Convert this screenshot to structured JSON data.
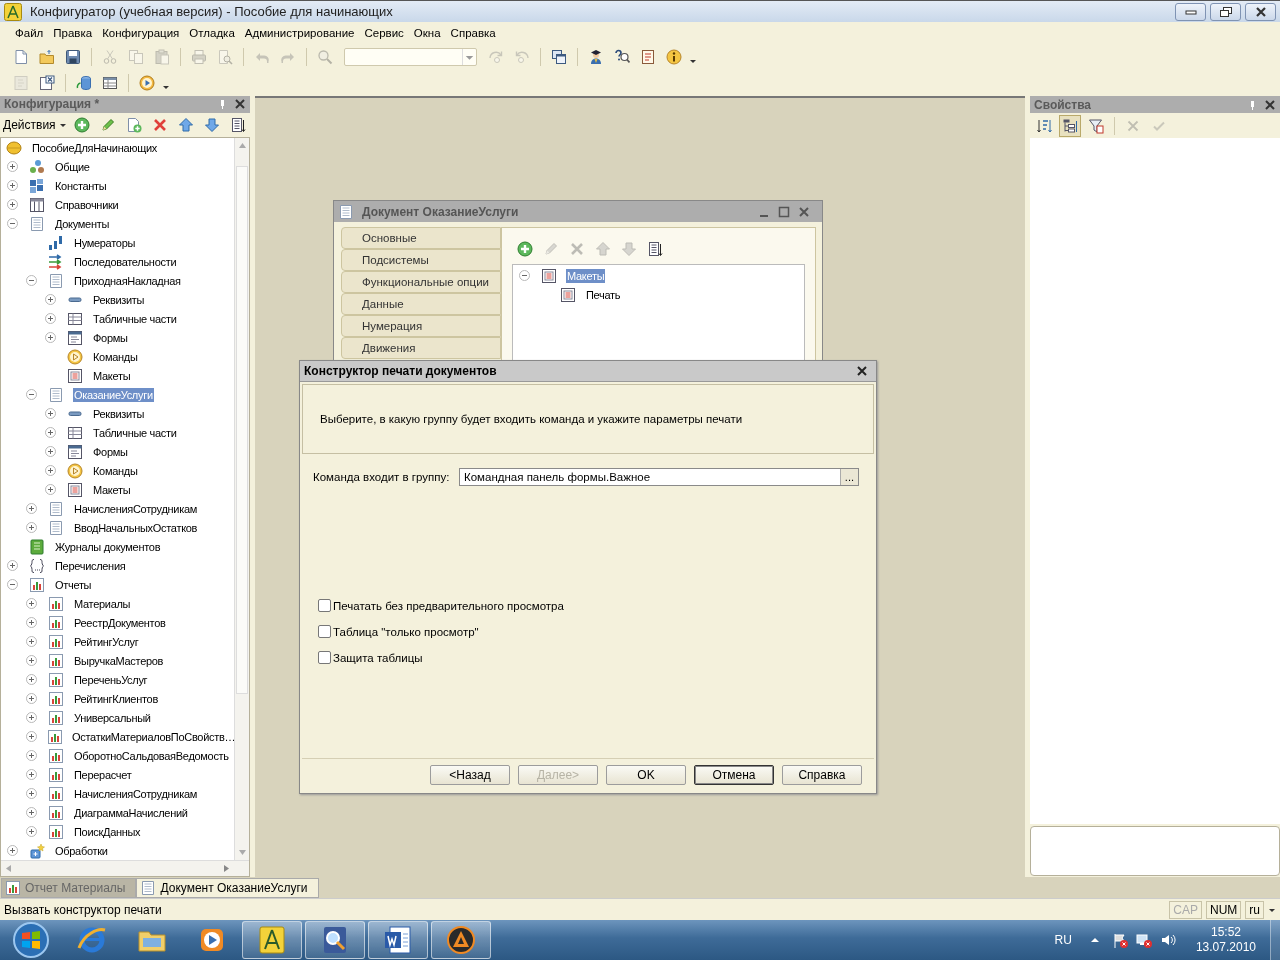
{
  "window": {
    "title": "Конфигуратор (учебная версия) - Пособие для начинающих"
  },
  "menu": [
    {
      "label": "Файл"
    },
    {
      "label": "Правка"
    },
    {
      "label": "Конфигурация"
    },
    {
      "label": "Отладка"
    },
    {
      "label": "Администрирование"
    },
    {
      "label": "Сервис"
    },
    {
      "label": "Окна"
    },
    {
      "label": "Справка"
    }
  ],
  "toolbar_main": [
    {
      "kind": "new",
      "disabled": false
    },
    {
      "kind": "open",
      "disabled": false
    },
    {
      "kind": "save",
      "disabled": false
    },
    {
      "kind": "separator"
    },
    {
      "kind": "cut",
      "disabled": true
    },
    {
      "kind": "copy",
      "disabled": true
    },
    {
      "kind": "paste",
      "disabled": true
    },
    {
      "kind": "separator"
    },
    {
      "kind": "print",
      "disabled": true
    },
    {
      "kind": "preview",
      "disabled": true
    },
    {
      "kind": "separator"
    },
    {
      "kind": "undo",
      "disabled": true
    },
    {
      "kind": "redo",
      "disabled": true
    },
    {
      "kind": "separator"
    },
    {
      "kind": "find",
      "disabled": true
    },
    {
      "kind": "searchbox"
    },
    {
      "kind": "findnext",
      "disabled": true
    },
    {
      "kind": "findprev",
      "disabled": true
    },
    {
      "kind": "separator"
    },
    {
      "kind": "windows",
      "disabled": false
    },
    {
      "kind": "separator"
    },
    {
      "kind": "help",
      "disabled": false
    },
    {
      "kind": "helpsearch",
      "disabled": false
    },
    {
      "kind": "syntax",
      "disabled": false
    },
    {
      "kind": "info",
      "disabled": false
    },
    {
      "kind": "more"
    }
  ],
  "toolbar_config": [
    {
      "kind": "cfg",
      "disabled": true
    },
    {
      "kind": "winx",
      "disabled": false
    },
    {
      "kind": "separator"
    },
    {
      "kind": "db",
      "disabled": false
    },
    {
      "kind": "table",
      "disabled": false
    },
    {
      "kind": "separator"
    },
    {
      "kind": "run",
      "disabled": false
    },
    {
      "kind": "more"
    }
  ],
  "config_panel": {
    "title": "Конфигурация *",
    "actions_label": "Действия",
    "toolbar": [
      {
        "kind": "add",
        "disabled": false
      },
      {
        "kind": "edit",
        "disabled": false
      },
      {
        "kind": "addcopy",
        "disabled": false
      },
      {
        "kind": "del",
        "disabled": false
      },
      {
        "kind": "up",
        "disabled": false
      },
      {
        "kind": "down",
        "disabled": false
      },
      {
        "kind": "list",
        "disabled": false
      }
    ],
    "tree": [
      {
        "label": "ПособиеДляНачинающих",
        "kind": "root",
        "selected": false,
        "children": [
          {
            "label": "Общие",
            "kind": "common",
            "expanded": false,
            "selected": false
          },
          {
            "label": "Константы",
            "kind": "constants",
            "expanded": false,
            "selected": false
          },
          {
            "label": "Справочники",
            "kind": "catalogs",
            "expanded": false,
            "selected": false
          },
          {
            "label": "Документы",
            "kind": "doc",
            "expanded": true,
            "selected": false,
            "children": [
              {
                "label": "Нумераторы",
                "kind": "numerators",
                "selected": false
              },
              {
                "label": "Последовательности",
                "kind": "sequences",
                "selected": false
              },
              {
                "label": "ПриходнаяНакладная",
                "kind": "doc",
                "expanded": true,
                "selected": false,
                "children": [
                  {
                    "label": "Реквизиты",
                    "kind": "attributes",
                    "expanded": false,
                    "selected": false
                  },
                  {
                    "label": "Табличные части",
                    "kind": "tabular",
                    "expanded": false,
                    "selected": false
                  },
                  {
                    "label": "Формы",
                    "kind": "forms",
                    "expanded": false,
                    "selected": false
                  },
                  {
                    "label": "Команды",
                    "kind": "commands",
                    "selected": false
                  },
                  {
                    "label": "Макеты",
                    "kind": "templates",
                    "selected": false
                  }
                ]
              },
              {
                "label": "ОказаниеУслуги",
                "kind": "doc",
                "expanded": true,
                "selected": true,
                "children": [
                  {
                    "label": "Реквизиты",
                    "kind": "attributes",
                    "expanded": false,
                    "selected": false
                  },
                  {
                    "label": "Табличные части",
                    "kind": "tabular",
                    "expanded": false,
                    "selected": false
                  },
                  {
                    "label": "Формы",
                    "kind": "forms",
                    "expanded": false,
                    "selected": false
                  },
                  {
                    "label": "Команды",
                    "kind": "commands",
                    "expanded": false,
                    "selected": false
                  },
                  {
                    "label": "Макеты",
                    "kind": "templates",
                    "expanded": false,
                    "selected": false
                  }
                ]
              },
              {
                "label": "НачисленияСотрудникам",
                "kind": "doc",
                "expanded": false,
                "selected": false
              },
              {
                "label": "ВводНачальныхОстатков",
                "kind": "doc",
                "expanded": false,
                "selected": false
              }
            ]
          },
          {
            "label": "Журналы документов",
            "kind": "journals",
            "selected": false
          },
          {
            "label": "Перечисления",
            "kind": "enums",
            "expanded": false,
            "selected": false
          },
          {
            "label": "Отчеты",
            "kind": "report",
            "expanded": true,
            "selected": false,
            "children": [
              {
                "label": "Материалы",
                "kind": "report",
                "expanded": false,
                "selected": false
              },
              {
                "label": "РеестрДокументов",
                "kind": "report",
                "expanded": false,
                "selected": false
              },
              {
                "label": "РейтингУслуг",
                "kind": "report",
                "expanded": false,
                "selected": false
              },
              {
                "label": "ВыручкаМастеров",
                "kind": "report",
                "expanded": false,
                "selected": false
              },
              {
                "label": "ПереченьУслуг",
                "kind": "report",
                "expanded": false,
                "selected": false
              },
              {
                "label": "РейтингКлиентов",
                "kind": "report",
                "expanded": false,
                "selected": false
              },
              {
                "label": "Универсальный",
                "kind": "report",
                "expanded": false,
                "selected": false
              },
              {
                "label": "ОстаткиМатериаловПоСвойств…",
                "kind": "report",
                "expanded": false,
                "selected": false
              },
              {
                "label": "ОборотноСальдоваяВедомость",
                "kind": "report",
                "expanded": false,
                "selected": false
              },
              {
                "label": "Перерасчет",
                "kind": "report",
                "expanded": false,
                "selected": false
              },
              {
                "label": "НачисленияСотрудникам",
                "kind": "report",
                "expanded": false,
                "selected": false
              },
              {
                "label": "ДиаграммаНачислений",
                "kind": "report",
                "expanded": false,
                "selected": false
              },
              {
                "label": "ПоискДанных",
                "kind": "report",
                "expanded": false,
                "selected": false
              }
            ]
          },
          {
            "label": "Обработки",
            "kind": "processing",
            "expanded": false,
            "selected": false
          }
        ]
      }
    ]
  },
  "document_window": {
    "title": "Документ ОказаниеУслуги",
    "tabs": [
      {
        "label": "Основные",
        "selected": false
      },
      {
        "label": "Подсистемы",
        "selected": false
      },
      {
        "label": "Функциональные опции",
        "selected": false
      },
      {
        "label": "Данные",
        "selected": false
      },
      {
        "label": "Нумерация",
        "selected": false
      },
      {
        "label": "Движения",
        "selected": false
      }
    ],
    "toolbar": [
      {
        "kind": "add",
        "disabled": false
      },
      {
        "kind": "edit",
        "disabled": true
      },
      {
        "kind": "del",
        "disabled": true
      },
      {
        "kind": "up",
        "disabled": true
      },
      {
        "kind": "down",
        "disabled": true
      },
      {
        "kind": "list",
        "disabled": false
      }
    ],
    "tree": [
      {
        "label": "Макеты",
        "kind": "templates",
        "expanded": true,
        "selected": true,
        "children": [
          {
            "label": "Печать",
            "kind": "templates",
            "selected": false
          }
        ]
      }
    ]
  },
  "dialog": {
    "title": "Конструктор печати документов",
    "description": "Выберите, в какую группу будет входить команда и укажите параметры печати",
    "field": {
      "label": "Команда входит в группу:",
      "value": "Командная панель формы.Важное",
      "button": "..."
    },
    "checkboxes": [
      {
        "label": "Печатать без предварительного просмотра",
        "checked": false
      },
      {
        "label": "Таблица \"только просмотр\"",
        "checked": false
      },
      {
        "label": "Защита таблицы",
        "checked": false
      }
    ],
    "buttons": [
      {
        "label": "<Назад",
        "disabled": false,
        "focused": false
      },
      {
        "label": "Далее>",
        "disabled": true,
        "focused": false
      },
      {
        "label": "OK",
        "disabled": false,
        "focused": false
      },
      {
        "label": "Отмена",
        "disabled": false,
        "focused": true
      },
      {
        "label": "Справка",
        "disabled": false,
        "focused": false
      }
    ]
  },
  "properties_panel": {
    "title": "Свойства",
    "toolbar": [
      {
        "kind": "sortaz",
        "disabled": false,
        "pressed": false
      },
      {
        "kind": "treeview",
        "disabled": false,
        "pressed": true
      },
      {
        "kind": "filter",
        "disabled": false,
        "pressed": false
      },
      {
        "kind": "separator"
      },
      {
        "kind": "cancel",
        "disabled": true,
        "pressed": false
      },
      {
        "kind": "ok",
        "disabled": true,
        "pressed": false
      }
    ]
  },
  "window_tabs": [
    {
      "label": "Отчет Материалы",
      "kind": "report",
      "selected": false
    },
    {
      "label": "Документ ОказаниеУслуги",
      "kind": "doc",
      "selected": true
    }
  ],
  "status_bar": {
    "text": "Вызвать конструктор печати",
    "indicators": [
      {
        "label": "CAP",
        "on": false
      },
      {
        "label": "NUM",
        "on": true
      },
      {
        "label": "ru",
        "on": true
      }
    ]
  },
  "taskbar": {
    "items": [
      {
        "kind": "ie",
        "running": false
      },
      {
        "kind": "explorer",
        "running": false
      },
      {
        "kind": "media",
        "running": false
      },
      {
        "kind": "configurator",
        "running": true
      },
      {
        "kind": "viewer",
        "running": true
      },
      {
        "kind": "word",
        "running": true
      },
      {
        "kind": "player",
        "running": true
      }
    ],
    "language": "RU",
    "time": "15:52",
    "date": "13.07.2010"
  }
}
